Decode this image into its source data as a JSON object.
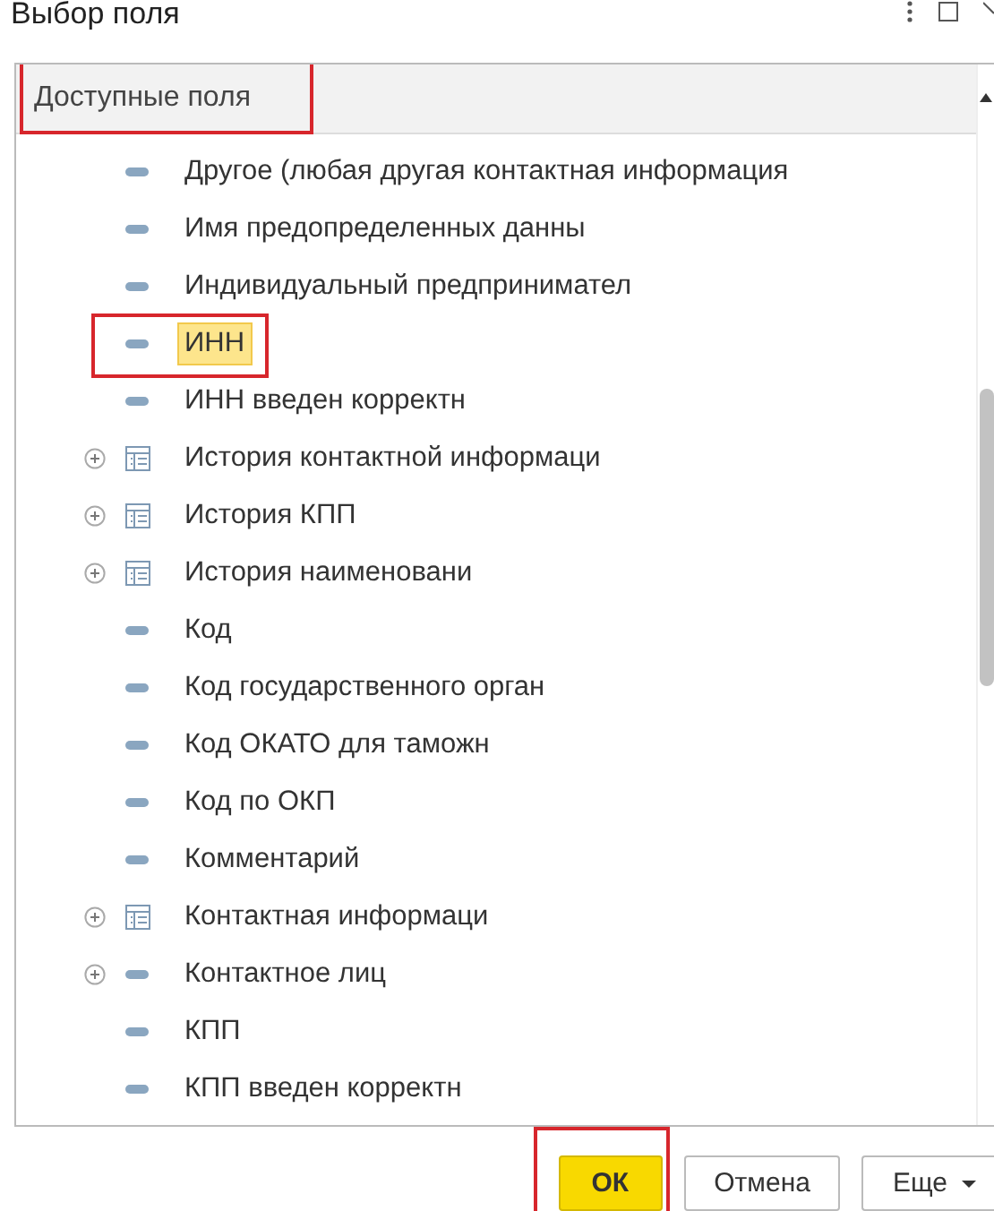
{
  "window": {
    "title": "Выбор поля"
  },
  "header": {
    "label": "Доступные поля",
    "annotated": true
  },
  "fields": [
    {
      "label": "Другое (любая другая контактная информация",
      "kind": "field",
      "expandable": false,
      "selected": false,
      "annotated": false
    },
    {
      "label": "Имя предопределенных данны",
      "kind": "field",
      "expandable": false,
      "selected": false,
      "annotated": false
    },
    {
      "label": "Индивидуальный предпринимател",
      "kind": "field",
      "expandable": false,
      "selected": false,
      "annotated": false
    },
    {
      "label": "ИНН",
      "kind": "field",
      "expandable": false,
      "selected": true,
      "annotated": true
    },
    {
      "label": "ИНН введен корректн",
      "kind": "field",
      "expandable": false,
      "selected": false,
      "annotated": false
    },
    {
      "label": "История контактной информаци",
      "kind": "table",
      "expandable": true,
      "selected": false,
      "annotated": false
    },
    {
      "label": "История КПП",
      "kind": "table",
      "expandable": true,
      "selected": false,
      "annotated": false
    },
    {
      "label": "История наименовани",
      "kind": "table",
      "expandable": true,
      "selected": false,
      "annotated": false
    },
    {
      "label": "Код",
      "kind": "field",
      "expandable": false,
      "selected": false,
      "annotated": false
    },
    {
      "label": "Код государственного орган",
      "kind": "field",
      "expandable": false,
      "selected": false,
      "annotated": false
    },
    {
      "label": "Код ОКАТО для таможн",
      "kind": "field",
      "expandable": false,
      "selected": false,
      "annotated": false
    },
    {
      "label": "Код по ОКП",
      "kind": "field",
      "expandable": false,
      "selected": false,
      "annotated": false
    },
    {
      "label": "Комментарий",
      "kind": "field",
      "expandable": false,
      "selected": false,
      "annotated": false
    },
    {
      "label": "Контактная информаци",
      "kind": "table",
      "expandable": true,
      "selected": false,
      "annotated": false
    },
    {
      "label": "Контактное лиц",
      "kind": "field",
      "expandable": true,
      "selected": false,
      "annotated": false
    },
    {
      "label": "КПП",
      "kind": "field",
      "expandable": false,
      "selected": false,
      "annotated": false
    },
    {
      "label": "КПП введен корректн",
      "kind": "field",
      "expandable": false,
      "selected": false,
      "annotated": false
    }
  ],
  "buttons": [
    {
      "label": "ОК",
      "kind": "default",
      "annotated": true
    },
    {
      "label": "Отмена",
      "kind": "plain",
      "annotated": false
    },
    {
      "label": "Еще",
      "kind": "menu",
      "annotated": false
    }
  ]
}
